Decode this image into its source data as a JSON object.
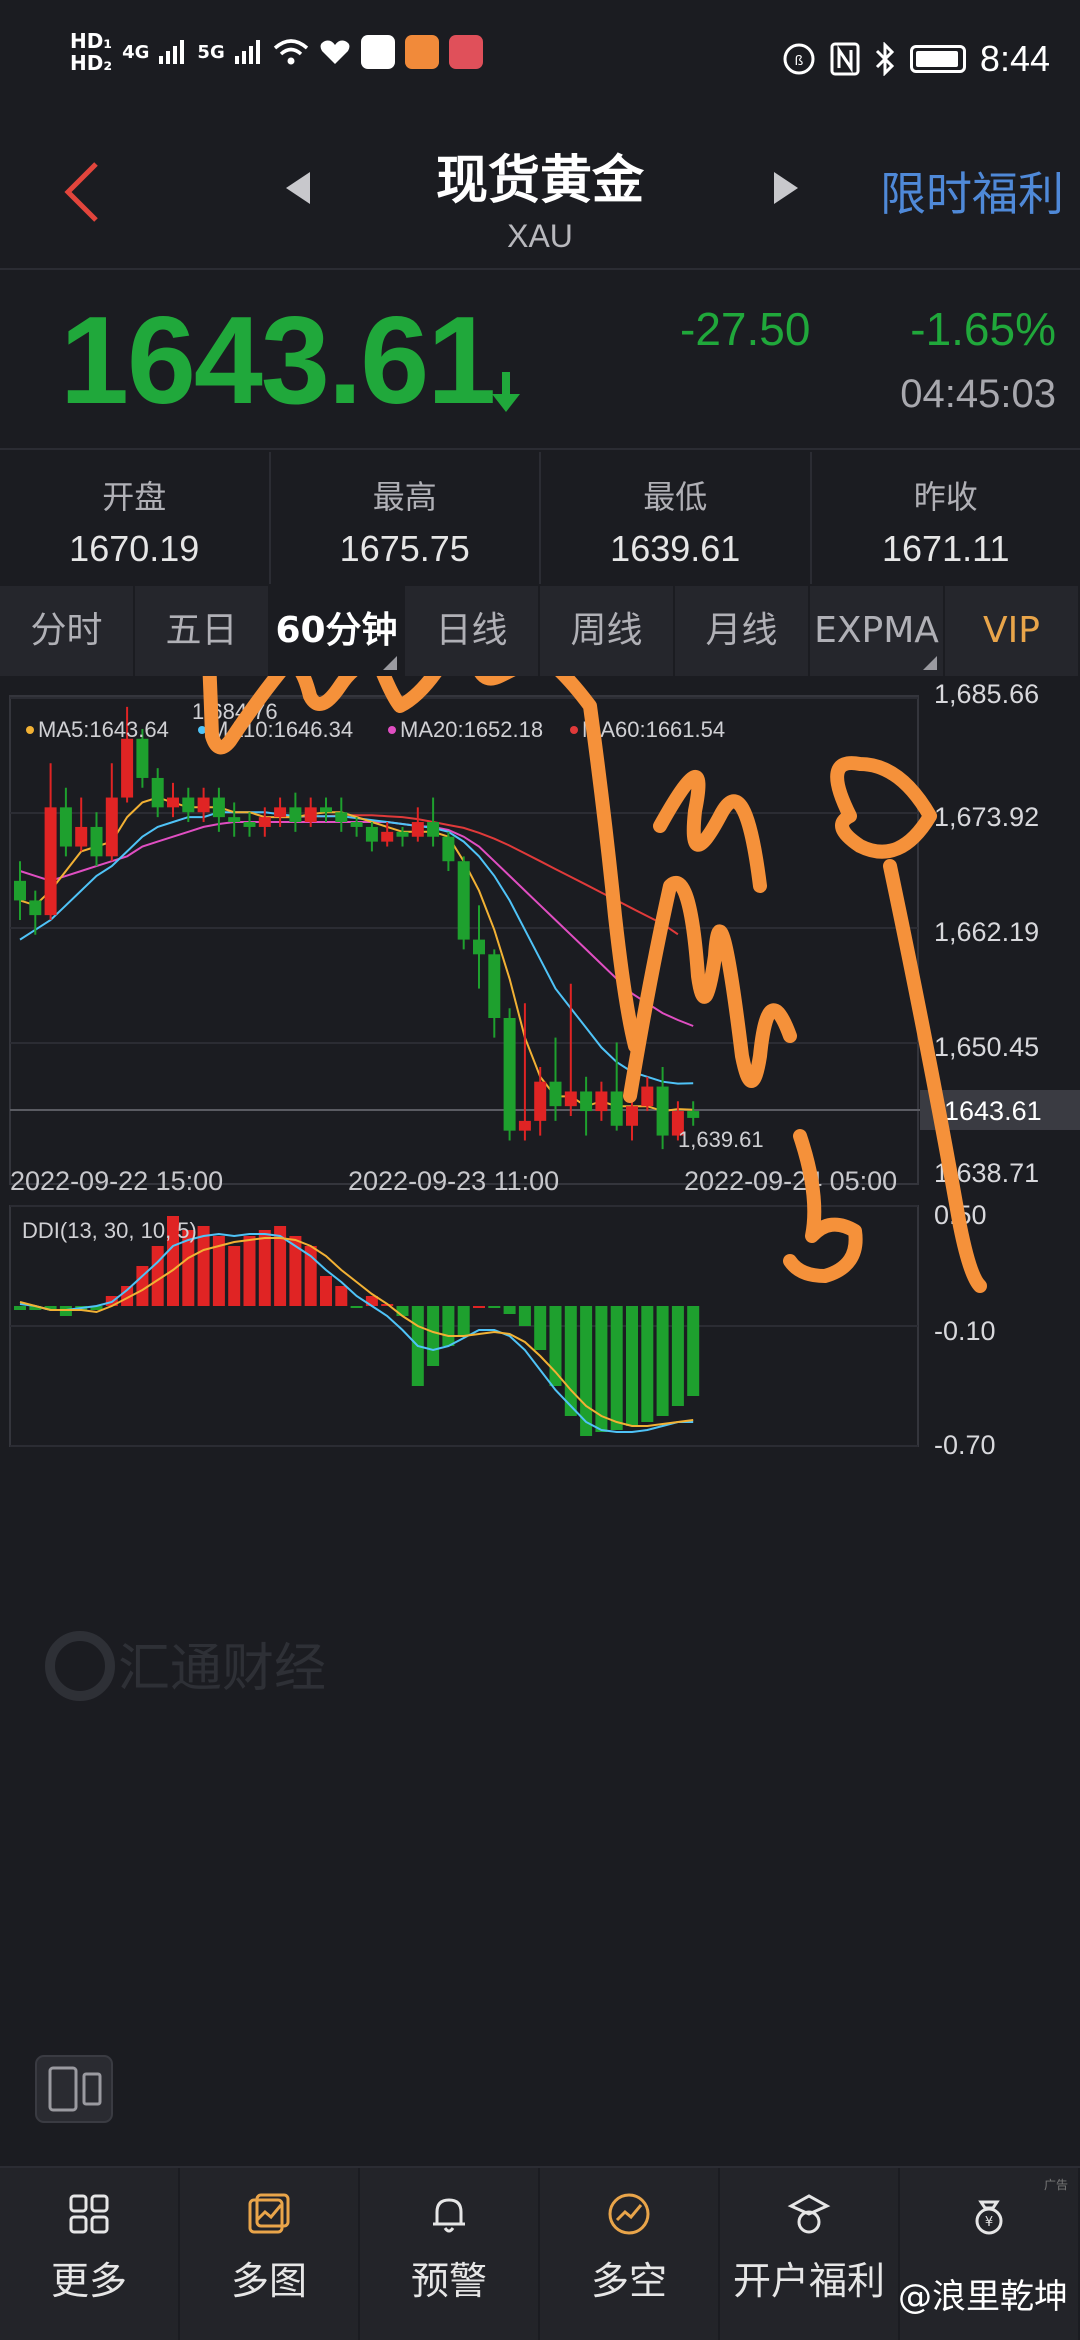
{
  "status_bar": {
    "hd1": "HD₁",
    "hd2": "HD₂",
    "sig1": "4G",
    "sig2": "5G",
    "nfc_icon": "nfc-icon",
    "time": "8:44",
    "app_colors": [
      "#ffffff",
      "#f18a3a",
      "#e0505a"
    ]
  },
  "header": {
    "title": "现货黄金",
    "subtitle": "XAU",
    "promo": "限时福利"
  },
  "quote": {
    "price": "1643.61",
    "change": "-27.50",
    "change_pct": "-1.65%",
    "time": "04:45:03"
  },
  "stats": [
    {
      "label": "开盘",
      "value": "1670.19"
    },
    {
      "label": "最高",
      "value": "1675.75"
    },
    {
      "label": "最低",
      "value": "1639.61"
    },
    {
      "label": "昨收",
      "value": "1671.11"
    }
  ],
  "tabs": [
    {
      "label": "分时"
    },
    {
      "label": "五日"
    },
    {
      "label": "60分钟"
    },
    {
      "label": "日线"
    },
    {
      "label": "周线"
    },
    {
      "label": "月线"
    },
    {
      "label": "EXPMA"
    },
    {
      "label": "VIP"
    }
  ],
  "main_chart": {
    "legend": [
      {
        "label": "MA5:1643.64",
        "color": "#f2b134"
      },
      {
        "label": "MA10:1646.34",
        "color": "#4fc3f7"
      },
      {
        "label": "MA20:1652.18",
        "color": "#e04ec2"
      },
      {
        "label": "MA60:1661.54",
        "color": "#e03a3a"
      }
    ],
    "y_ticks": [
      "1,685.66",
      "1,673.92",
      "1,662.19",
      "1,650.45",
      "1,638.71"
    ],
    "current_price_tag": "1643.61",
    "high_label": "1,684.76",
    "low_label": "1,639.61",
    "x_ticks": [
      "2022-09-22 15:00",
      "2022-09-23 11:00",
      "2022-09-24 05:00"
    ],
    "watermark": "汇通财经"
  },
  "sub_chart": {
    "title": "DDI(13, 30, 10, 5)",
    "y_ticks": [
      "0.50",
      "-0.10",
      "-0.70"
    ]
  },
  "annotations": [
    "a",
    "c",
    "b"
  ],
  "chart_data": {
    "type": "candlestick",
    "ylim": [
      1638.71,
      1685.66
    ],
    "candles": [
      {
        "o": 1667,
        "c": 1665,
        "h": 1669,
        "l": 1663
      },
      {
        "o": 1665,
        "c": 1663.5,
        "h": 1666,
        "l": 1661.5
      },
      {
        "o": 1663.5,
        "c": 1674.5,
        "h": 1679,
        "l": 1663
      },
      {
        "o": 1674.5,
        "c": 1670.5,
        "h": 1676.5,
        "l": 1669.5
      },
      {
        "o": 1670.5,
        "c": 1672.5,
        "h": 1675.5,
        "l": 1670
      },
      {
        "o": 1672.5,
        "c": 1669.5,
        "h": 1674,
        "l": 1668.5
      },
      {
        "o": 1669.5,
        "c": 1675.5,
        "h": 1679,
        "l": 1669
      },
      {
        "o": 1675.5,
        "c": 1681.5,
        "h": 1684.76,
        "l": 1675
      },
      {
        "o": 1681.5,
        "c": 1677.5,
        "h": 1682.5,
        "l": 1676.5
      },
      {
        "o": 1677.5,
        "c": 1674.5,
        "h": 1678.5,
        "l": 1673.5
      },
      {
        "o": 1674.5,
        "c": 1675.5,
        "h": 1677,
        "l": 1673.5
      },
      {
        "o": 1675.5,
        "c": 1674,
        "h": 1676.5,
        "l": 1673
      },
      {
        "o": 1674,
        "c": 1675.5,
        "h": 1676.5,
        "l": 1673
      },
      {
        "o": 1675.5,
        "c": 1673.5,
        "h": 1676.5,
        "l": 1672
      },
      {
        "o": 1673.5,
        "c": 1673,
        "h": 1675,
        "l": 1671.5
      },
      {
        "o": 1673,
        "c": 1672.5,
        "h": 1674,
        "l": 1671.5
      },
      {
        "o": 1672.5,
        "c": 1673.5,
        "h": 1674.5,
        "l": 1671.5
      },
      {
        "o": 1673.5,
        "c": 1674.5,
        "h": 1675.5,
        "l": 1672.5
      },
      {
        "o": 1674.5,
        "c": 1673,
        "h": 1676,
        "l": 1672
      },
      {
        "o": 1673,
        "c": 1674.5,
        "h": 1675.5,
        "l": 1672.5
      },
      {
        "o": 1674.5,
        "c": 1674,
        "h": 1675.5,
        "l": 1673
      },
      {
        "o": 1674,
        "c": 1673,
        "h": 1675.5,
        "l": 1672
      },
      {
        "o": 1673,
        "c": 1672.5,
        "h": 1673.5,
        "l": 1671.5
      },
      {
        "o": 1672.5,
        "c": 1671,
        "h": 1673,
        "l": 1670
      },
      {
        "o": 1671,
        "c": 1672,
        "h": 1673,
        "l": 1670.5
      },
      {
        "o": 1672,
        "c": 1671.5,
        "h": 1672.5,
        "l": 1670.5
      },
      {
        "o": 1671.5,
        "c": 1673,
        "h": 1674.5,
        "l": 1671
      },
      {
        "o": 1673,
        "c": 1671.5,
        "h": 1675.5,
        "l": 1670.5
      },
      {
        "o": 1671.5,
        "c": 1669,
        "h": 1672,
        "l": 1668
      },
      {
        "o": 1669,
        "c": 1661,
        "h": 1669.5,
        "l": 1660
      },
      {
        "o": 1661,
        "c": 1659.5,
        "h": 1664.5,
        "l": 1656
      },
      {
        "o": 1659.5,
        "c": 1653,
        "h": 1660,
        "l": 1651
      },
      {
        "o": 1653,
        "c": 1641.5,
        "h": 1654,
        "l": 1640.5
      },
      {
        "o": 1641.5,
        "c": 1642.5,
        "h": 1654.5,
        "l": 1640.5
      },
      {
        "o": 1642.5,
        "c": 1646.5,
        "h": 1648,
        "l": 1641
      },
      {
        "o": 1646.5,
        "c": 1644,
        "h": 1651,
        "l": 1642.5
      },
      {
        "o": 1644,
        "c": 1645.5,
        "h": 1656.5,
        "l": 1643
      },
      {
        "o": 1645.5,
        "c": 1643.5,
        "h": 1647,
        "l": 1641
      },
      {
        "o": 1643.5,
        "c": 1645.5,
        "h": 1646.5,
        "l": 1642.5
      },
      {
        "o": 1645.5,
        "c": 1642,
        "h": 1650.5,
        "l": 1641.5
      },
      {
        "o": 1642,
        "c": 1644,
        "h": 1650,
        "l": 1640.5
      },
      {
        "o": 1644,
        "c": 1646,
        "h": 1647,
        "l": 1643.5
      },
      {
        "o": 1646,
        "c": 1641,
        "h": 1648,
        "l": 1639.61
      },
      {
        "o": 1641,
        "c": 1643.5,
        "h": 1644.5,
        "l": 1640.5
      },
      {
        "o": 1643.5,
        "c": 1642.8,
        "h": 1644.5,
        "l": 1642
      }
    ],
    "ma5": [
      1665,
      1664.5,
      1666,
      1668,
      1670,
      1670.5,
      1671,
      1673.5,
      1675,
      1675.5,
      1675,
      1674.5,
      1674.5,
      1674.5,
      1674,
      1674,
      1673.5,
      1673.5,
      1673.5,
      1673.8,
      1674,
      1674,
      1673.5,
      1673,
      1672.5,
      1672,
      1672,
      1672,
      1671.5,
      1669,
      1666,
      1662,
      1657,
      1651,
      1647,
      1645,
      1645,
      1644,
      1644.5,
      1644,
      1644,
      1644,
      1643.5,
      1643.7,
      1643.64
    ],
    "ma10": [
      1661,
      1662,
      1663,
      1664.5,
      1666,
      1667.5,
      1668.5,
      1670,
      1671.5,
      1672.5,
      1673,
      1673.5,
      1673.5,
      1674,
      1674,
      1674,
      1674,
      1673.8,
      1673.6,
      1673.6,
      1673.6,
      1673.6,
      1673.4,
      1673.2,
      1673,
      1672.8,
      1672.6,
      1672.4,
      1672,
      1671,
      1669.5,
      1667.5,
      1665,
      1662,
      1659,
      1656,
      1654,
      1652,
      1650,
      1648.5,
      1647.5,
      1647,
      1646.5,
      1646.3,
      1646.34
    ],
    "ma20": [
      1668,
      1667.5,
      1667,
      1667.5,
      1668,
      1668.5,
      1669,
      1669.5,
      1670.5,
      1671,
      1671.5,
      1672,
      1672.5,
      1672.8,
      1673,
      1673,
      1673,
      1673,
      1673,
      1673,
      1673,
      1673,
      1673,
      1673,
      1673,
      1672.8,
      1672.6,
      1672.5,
      1672.2,
      1671.5,
      1670.5,
      1669,
      1667.5,
      1666,
      1664.5,
      1663,
      1661.5,
      1660,
      1658.5,
      1657,
      1655.5,
      1654.5,
      1653.5,
      1652.8,
      1652.18
    ],
    "ma60_start_index": 17,
    "ma60": [
      1673.5,
      1673.5,
      1673.6,
      1673.6,
      1673.7,
      1673.7,
      1673.7,
      1673.6,
      1673.5,
      1673.3,
      1673,
      1672.7,
      1672.4,
      1671.9,
      1671.3,
      1670.6,
      1669.8,
      1669,
      1668.2,
      1667.4,
      1666.6,
      1665.8,
      1665,
      1664.2,
      1663.4,
      1662.6,
      1661.54
    ],
    "ddi_ylim": [
      -0.7,
      0.5
    ],
    "ddi_bars": [
      -0.02,
      -0.02,
      -0.02,
      -0.05,
      -0.02,
      -0.02,
      0.05,
      0.1,
      0.2,
      0.3,
      0.45,
      0.38,
      0.4,
      0.35,
      0.3,
      0.35,
      0.38,
      0.4,
      0.35,
      0.3,
      0.15,
      0.1,
      -0.01,
      0.05,
      0.01,
      -0.05,
      -0.4,
      -0.3,
      -0.2,
      -0.15,
      0.0,
      -0.01,
      -0.04,
      -0.1,
      -0.22,
      -0.4,
      -0.55,
      -0.65,
      -0.63,
      -0.62,
      -0.6,
      -0.58,
      -0.55,
      -0.5,
      -0.45
    ],
    "ddi_line1": [
      0.02,
      0.0,
      -0.02,
      -0.02,
      -0.02,
      -0.03,
      0.0,
      0.04,
      0.08,
      0.13,
      0.18,
      0.24,
      0.28,
      0.3,
      0.32,
      0.33,
      0.34,
      0.34,
      0.33,
      0.3,
      0.25,
      0.18,
      0.12,
      0.06,
      0.01,
      -0.05,
      -0.1,
      -0.13,
      -0.15,
      -0.15,
      -0.14,
      -0.13,
      -0.14,
      -0.18,
      -0.25,
      -0.33,
      -0.42,
      -0.5,
      -0.55,
      -0.58,
      -0.6,
      -0.6,
      -0.59,
      -0.58,
      -0.57
    ],
    "ddi_line2": [
      0.01,
      0.0,
      -0.02,
      -0.02,
      -0.01,
      0.0,
      0.02,
      0.08,
      0.15,
      0.22,
      0.3,
      0.33,
      0.35,
      0.36,
      0.35,
      0.36,
      0.36,
      0.35,
      0.3,
      0.25,
      0.18,
      0.12,
      0.05,
      0.0,
      -0.05,
      -0.12,
      -0.2,
      -0.22,
      -0.2,
      -0.16,
      -0.12,
      -0.12,
      -0.15,
      -0.22,
      -0.32,
      -0.42,
      -0.5,
      -0.58,
      -0.62,
      -0.63,
      -0.63,
      -0.62,
      -0.6,
      -0.58,
      -0.58
    ]
  }
}
